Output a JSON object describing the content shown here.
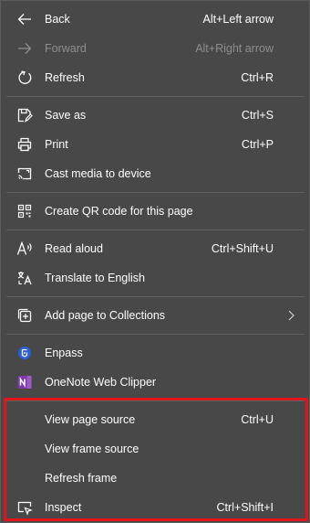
{
  "menu": {
    "back": {
      "label": "Back",
      "shortcut": "Alt+Left arrow"
    },
    "forward": {
      "label": "Forward",
      "shortcut": "Alt+Right arrow"
    },
    "refresh": {
      "label": "Refresh",
      "shortcut": "Ctrl+R"
    },
    "save_as": {
      "label": "Save as",
      "shortcut": "Ctrl+S"
    },
    "print": {
      "label": "Print",
      "shortcut": "Ctrl+P"
    },
    "cast": {
      "label": "Cast media to device"
    },
    "qr_code": {
      "label": "Create QR code for this page"
    },
    "read_aloud": {
      "label": "Read aloud",
      "shortcut": "Ctrl+Shift+U"
    },
    "translate": {
      "label": "Translate to English"
    },
    "collections": {
      "label": "Add page to Collections"
    },
    "enpass": {
      "label": "Enpass"
    },
    "onenote": {
      "label": "OneNote Web Clipper"
    },
    "view_source": {
      "label": "View page source",
      "shortcut": "Ctrl+U"
    },
    "view_frame_source": {
      "label": "View frame source"
    },
    "refresh_frame": {
      "label": "Refresh frame"
    },
    "inspect": {
      "label": "Inspect",
      "shortcut": "Ctrl+Shift+I"
    }
  },
  "colors": {
    "menu_background": "#484848",
    "text": "#ffffff",
    "disabled_text": "#8e8e8e",
    "highlight_border": "#e0151b",
    "enpass_blue": "#2a5fd6",
    "onenote_purple": "#7b3aa8"
  },
  "icons": [
    "back-arrow-icon",
    "forward-arrow-icon",
    "refresh-icon",
    "save-as-icon",
    "print-icon",
    "cast-icon",
    "qr-code-icon",
    "read-aloud-icon",
    "translate-icon",
    "collections-icon",
    "enpass-icon",
    "onenote-icon",
    "chevron-right-icon",
    "inspect-icon"
  ]
}
